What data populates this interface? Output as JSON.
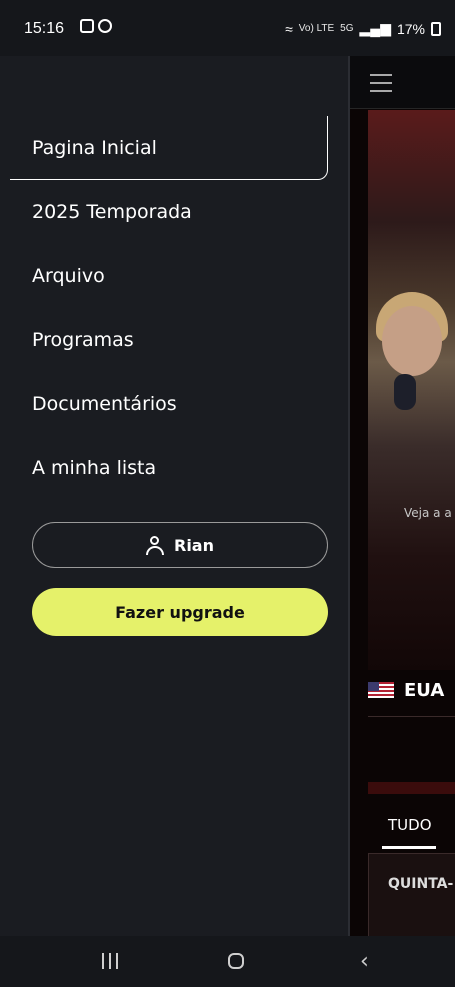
{
  "status_bar": {
    "time": "15:16",
    "network_label": "Vo) LTE",
    "signal_label": "5G",
    "battery": "17%"
  },
  "drawer": {
    "menu_items": [
      {
        "label": "Pagina Inicial",
        "active": true
      },
      {
        "label": "2025 Temporada",
        "active": false
      },
      {
        "label": "Arquivo",
        "active": false
      },
      {
        "label": "Programas",
        "active": false
      },
      {
        "label": "Documentários",
        "active": false
      },
      {
        "label": "A minha lista",
        "active": false
      }
    ],
    "user_name": "Rian",
    "upgrade_label": "Fazer upgrade"
  },
  "background": {
    "caption": "Veja a a",
    "country": "EUA",
    "tab_label": "TUDO",
    "day_label": "QUINTA-"
  },
  "colors": {
    "drawer_bg": "#1a1c21",
    "accent": "#e5f16a"
  }
}
